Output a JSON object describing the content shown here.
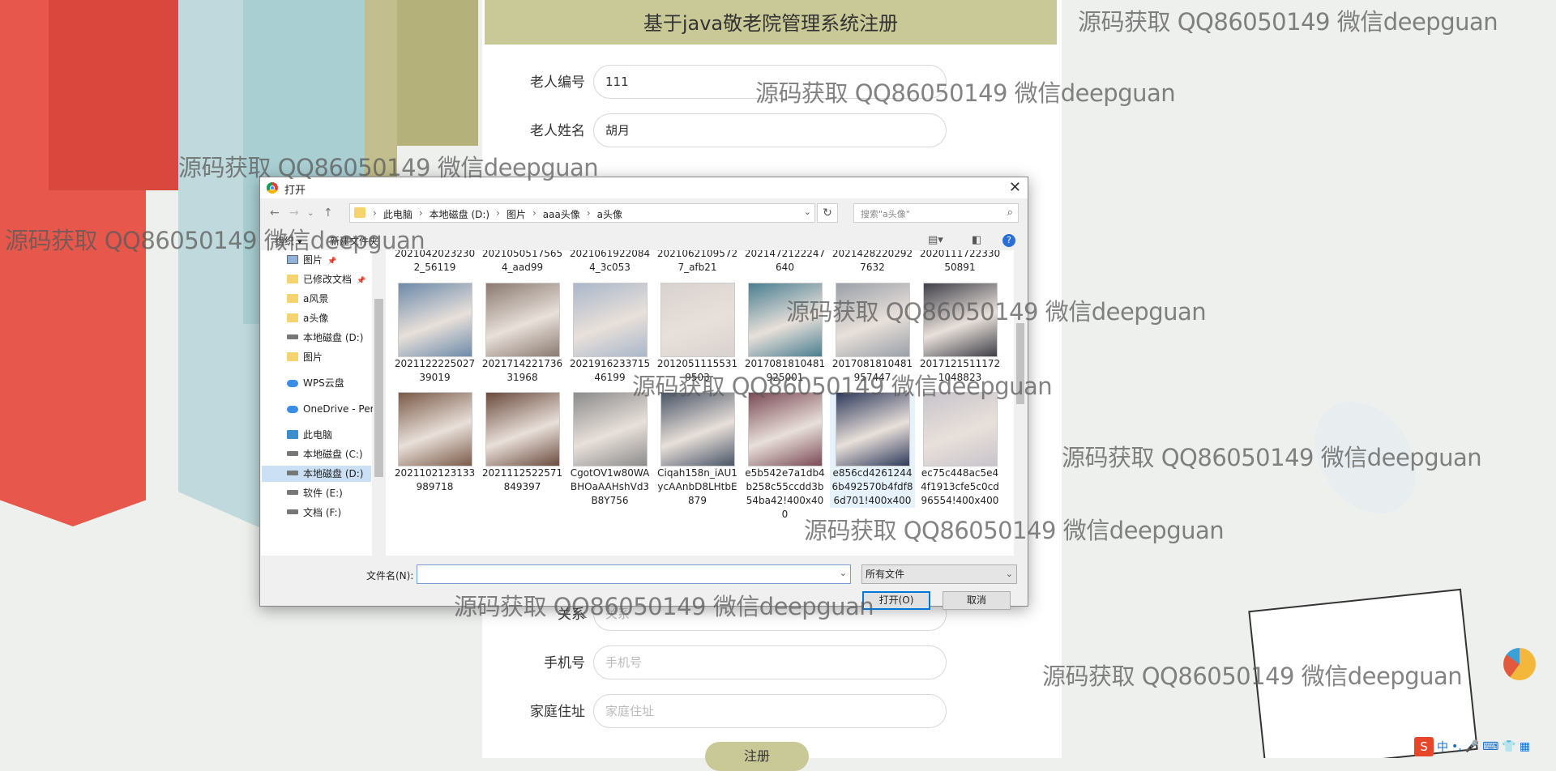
{
  "page": {
    "title": "基于java敬老院管理系统注册",
    "submit_label": "注册"
  },
  "form": {
    "fields": [
      {
        "label": "老人编号",
        "value": "111",
        "placeholder": ""
      },
      {
        "label": "老人姓名",
        "value": "胡月",
        "placeholder": ""
      },
      {
        "label": "关系",
        "value": "",
        "placeholder": "关系"
      },
      {
        "label": "手机号",
        "value": "",
        "placeholder": "手机号"
      },
      {
        "label": "家庭住址",
        "value": "",
        "placeholder": "家庭住址"
      }
    ]
  },
  "watermark": "源码获取 QQ86050149 微信deepguan",
  "dialog": {
    "title": "打开",
    "breadcrumbs": [
      "此电脑",
      "本地磁盘 (D:)",
      "图片",
      "aaa头像",
      "a头像"
    ],
    "search_placeholder": "搜索\"a头像\"",
    "toolbar": {
      "organize": "组织 ▾",
      "new_folder": "新建文件夹"
    },
    "nav_items": [
      {
        "label": "图片",
        "icon": "picture-folder-icon",
        "pinned": true
      },
      {
        "label": "已修改文档",
        "icon": "folder-icon",
        "pinned": true
      },
      {
        "label": "a风景",
        "icon": "folder-icon"
      },
      {
        "label": "a头像",
        "icon": "folder-icon"
      },
      {
        "label": "本地磁盘 (D:)",
        "icon": "drive-icon"
      },
      {
        "label": "图片",
        "icon": "folder-icon"
      },
      {
        "label": "WPS云盘",
        "icon": "cloud-icon"
      },
      {
        "label": "OneDrive - Pers",
        "icon": "onedrive-icon"
      },
      {
        "label": "此电脑",
        "icon": "computer-icon"
      },
      {
        "label": "本地磁盘 (C:)",
        "icon": "drive-icon"
      },
      {
        "label": "本地磁盘 (D:)",
        "icon": "drive-icon",
        "selected": true
      },
      {
        "label": "软件 (E:)",
        "icon": "drive-icon"
      },
      {
        "label": "文档 (F:)",
        "icon": "drive-icon"
      }
    ],
    "top_row": [
      "20210420232302_56119",
      "20210505175654_aad99",
      "20210619220844_3c053",
      "20210621095727_afb21",
      "2021472122247640",
      "20214282202927632",
      "2020111722330 50891"
    ],
    "row2": [
      "202112222502739019",
      "202171422173631968",
      "202191623371546199",
      "20120511155319503",
      "2017081810481925001",
      "2017081810481957447",
      "20171215111721048823"
    ],
    "row3": [
      "2021102123133989718",
      "2021112522571849397",
      "CgotOV1w80WABHOaAAHshVd3B8Y756",
      "Ciqah158n_iAU1ycAAnbD8LHtbE879",
      "e5b542e7a1db4b258c55ccdd3b54ba42!400x400",
      "e856cd42612446b492570b4fdf86d701!400x400",
      "ec75c448ac5e44f1913cfe5c0cd96554!400x400"
    ],
    "thumb_colors_row2": [
      "#6d8aa8",
      "#8a7a70",
      "#aab7c9",
      "#d8d2cf",
      "#4a7e8f",
      "#9aa0a8",
      "#3f3f48"
    ],
    "thumb_colors_row3": [
      "#7a5a48",
      "#6b4b3e",
      "#8c8c8c",
      "#4a5566",
      "#7a4a55",
      "#2f3a5a",
      "#c8c4cc"
    ],
    "filename_label": "文件名(N):",
    "filetype": "所有文件",
    "open_button": "打开(O)",
    "cancel_button": "取消"
  },
  "tray": {
    "ime": "S",
    "lang": "中"
  }
}
